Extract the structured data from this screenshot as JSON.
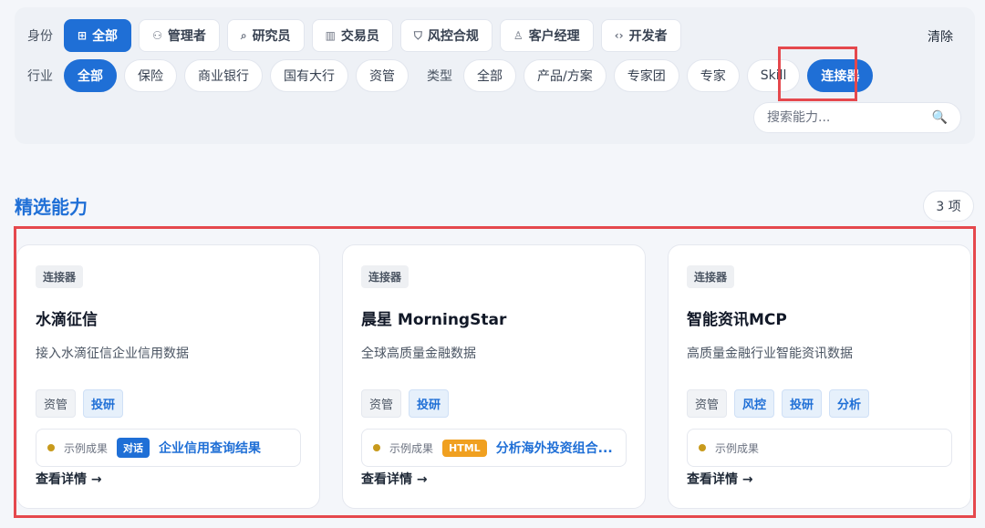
{
  "filters": {
    "identity_label": "身份",
    "identity_chips": [
      {
        "label": "全部",
        "icon": "⊞"
      },
      {
        "label": "管理者",
        "icon": "⚇"
      },
      {
        "label": "研究员",
        "icon": "⌕"
      },
      {
        "label": "交易员",
        "icon": "▥"
      },
      {
        "label": "风控合规",
        "icon": "⛉"
      },
      {
        "label": "客户经理",
        "icon": "♙"
      },
      {
        "label": "开发者",
        "icon": "‹›"
      }
    ],
    "clear_label": "清除",
    "industry_label": "行业",
    "industry_chips": [
      "全部",
      "保险",
      "商业银行",
      "国有大行",
      "资管"
    ],
    "type_label": "类型",
    "type_chips": [
      "全部",
      "产品/方案",
      "专家团",
      "专家",
      "Skill",
      "连接器"
    ],
    "search_placeholder": "搜索能力..."
  },
  "section": {
    "title": "精选能力",
    "count": "3 项"
  },
  "cards": [
    {
      "type_tag": "连接器",
      "title": "水滴征信",
      "desc": "接入水滴征信企业信用数据",
      "tags": [
        {
          "label": "资管",
          "style": "gray"
        },
        {
          "label": "投研",
          "style": "blue"
        }
      ],
      "result_label": "示例成果",
      "result_badge": "对话",
      "result_link": "企业信用查询结果",
      "detail": "查看详情 →"
    },
    {
      "type_tag": "连接器",
      "title": "晨星 MorningStar",
      "desc": "全球高质量金融数据",
      "tags": [
        {
          "label": "资管",
          "style": "gray"
        },
        {
          "label": "投研",
          "style": "blue"
        }
      ],
      "result_label": "示例成果",
      "result_badge": "HTML",
      "result_link": "分析海外投资组合...",
      "detail": "查看详情 →"
    },
    {
      "type_tag": "连接器",
      "title": "智能资讯MCP",
      "desc": "高质量金融行业智能资讯数据",
      "tags": [
        {
          "label": "资管",
          "style": "gray"
        },
        {
          "label": "风控",
          "style": "blue"
        },
        {
          "label": "投研",
          "style": "blue"
        },
        {
          "label": "分析",
          "style": "blue"
        }
      ],
      "result_label": "示例成果",
      "detail": "查看详情 →"
    }
  ]
}
